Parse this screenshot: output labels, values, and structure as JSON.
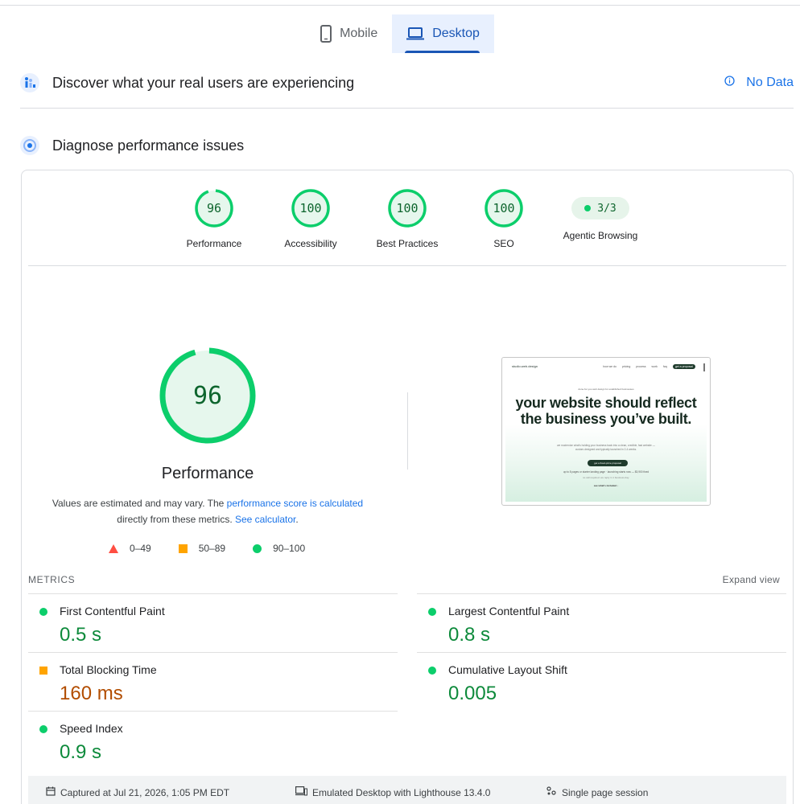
{
  "tabs": [
    {
      "label": "Mobile",
      "icon": "phone-icon",
      "active": false
    },
    {
      "label": "Desktop",
      "icon": "laptop-icon",
      "active": true
    }
  ],
  "field_data": {
    "title": "Discover what your real users are experiencing",
    "status": "No Data"
  },
  "diagnose": {
    "title": "Diagnose performance issues"
  },
  "categories": [
    {
      "label": "Performance",
      "score": "96",
      "fraction": 0.96
    },
    {
      "label": "Accessibility",
      "score": "100",
      "fraction": 1.0
    },
    {
      "label": "Best Practices",
      "score": "100",
      "fraction": 1.0
    },
    {
      "label": "SEO",
      "score": "100",
      "fraction": 1.0
    },
    {
      "label": "Agentic Browsing",
      "score": "3/3"
    }
  ],
  "performance": {
    "score": "96",
    "fraction": 0.96,
    "title": "Performance",
    "desc_prefix": "Values are estimated and may vary. The ",
    "desc_link1": "performance score is calculated",
    "desc_mid": " directly from these metrics. ",
    "desc_link2": "See calculator",
    "desc_suffix": "."
  },
  "legend": [
    {
      "range": "0–49",
      "shape": "triangle",
      "color": "#ff4e42"
    },
    {
      "range": "50–89",
      "shape": "square",
      "color": "#ffa400"
    },
    {
      "range": "90–100",
      "shape": "circle",
      "color": "#0cce6b"
    }
  ],
  "thumbnail": {
    "brand": "studio.web.design",
    "nav": [
      "how we do",
      "pricing",
      "process",
      "work",
      "faq"
    ],
    "nav_button": "get a proposal",
    "kicker": "done-for-you web design for established businesses",
    "headline": "your website should reflect the business you’ve built.",
    "sub": "we modernize what's holding your business back into a clean, credible, fast website — custom-designed and typically launched in 2-4 weeks.",
    "cta": "get a fixed-price proposal",
    "line1": "up to 8 pages or starter landing page · launching starts now — $3,900 fixed",
    "line2": "no call required. we reply in 1 business day.",
    "line3": "see what's included ↓"
  },
  "metrics": {
    "heading": "METRICS",
    "expand_label": "Expand view",
    "items": [
      {
        "name": "First Contentful Paint",
        "value": "0.5 s",
        "rating": "good"
      },
      {
        "name": "Largest Contentful Paint",
        "value": "0.8 s",
        "rating": "good"
      },
      {
        "name": "Total Blocking Time",
        "value": "160 ms",
        "rating": "average"
      },
      {
        "name": "Cumulative Layout Shift",
        "value": "0.005",
        "rating": "good"
      },
      {
        "name": "Speed Index",
        "value": "0.9 s",
        "rating": "good"
      }
    ]
  },
  "footer": {
    "captured": "Captured at Jul 21, 2026, 1:05 PM EDT",
    "emulated": "Emulated Desktop with Lighthouse 13.4.0",
    "session": "Single page session"
  },
  "colors": {
    "good": "#0cce6b",
    "average": "#ffa400",
    "poor": "#ff4e42",
    "accent": "#1a73e8"
  }
}
